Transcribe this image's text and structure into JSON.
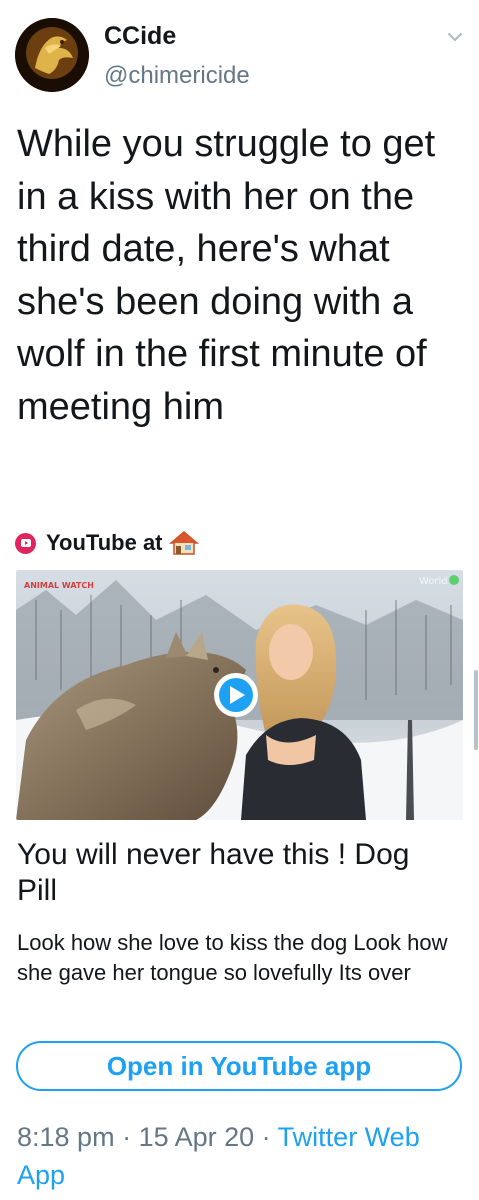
{
  "author": {
    "display_name": "CCide",
    "handle": "@chimericide"
  },
  "tweet": {
    "text": "While you struggle to get in a kiss with her on the third date, here's what she's been doing with a wolf in the first minute of meeting him"
  },
  "source": {
    "label": "YouTube at",
    "icon": "house-icon"
  },
  "card": {
    "title": "You will never have this ! Dog Pill",
    "description": "Look how she love to kiss the dog Look how she gave her tongue so lovefully Its over",
    "watermark_left": "ANIMAL WATCH",
    "watermark_right": "World",
    "button_label": "Open in YouTube app"
  },
  "meta": {
    "time": "8:18 pm",
    "sep1": " · ",
    "date": "15 Apr 20",
    "sep2": " · ",
    "client": "Twitter Web App"
  },
  "colors": {
    "accent": "#1da1f2",
    "youtube_red": "#e0245e",
    "secondary_text": "#657786"
  }
}
